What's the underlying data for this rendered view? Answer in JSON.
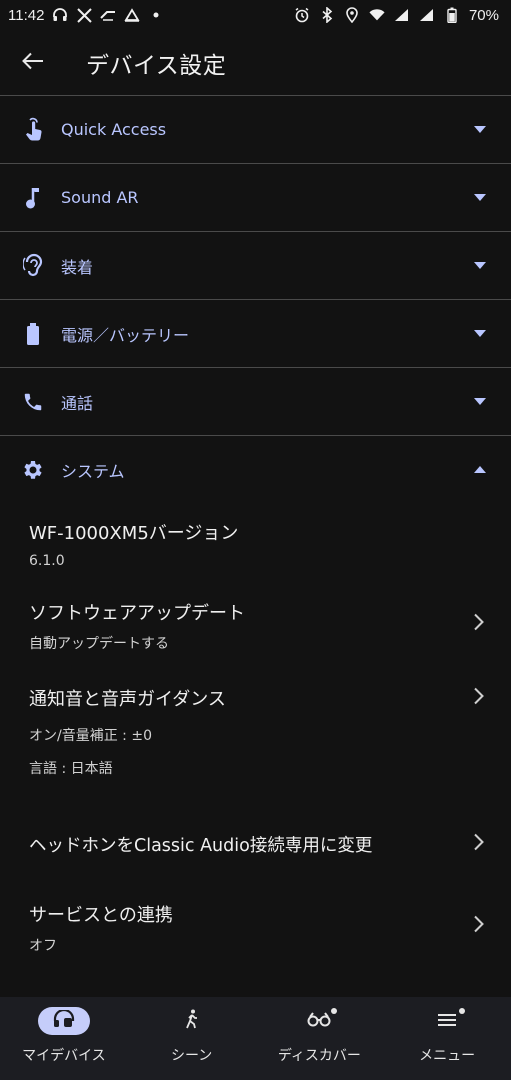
{
  "status_bar": {
    "time": "11:42",
    "battery_text": "70%"
  },
  "app_bar": {
    "title": "デバイス設定"
  },
  "sections": [
    {
      "label": "Quick Access",
      "icon": "touch-icon"
    },
    {
      "label": "Sound AR",
      "icon": "music-note-icon"
    },
    {
      "label": "装着",
      "icon": "ear-icon"
    },
    {
      "label": "電源／バッテリー",
      "icon": "battery-icon"
    },
    {
      "label": "通話",
      "icon": "phone-icon"
    },
    {
      "label": "システム",
      "icon": "gear-icon"
    }
  ],
  "system": {
    "version_title": "WF-1000XM5バージョン",
    "version_value": "6.1.0",
    "software_update_title": "ソフトウェアアップデート",
    "software_update_sub": "自動アップデートする",
    "notification_title": "通知音と音声ガイダンス",
    "notification_sub1": "オン/音量補正 : ±0",
    "notification_sub2": "言語 : 日本語",
    "classic_audio_title": "ヘッドホンをClassic Audio接続専用に変更",
    "services_title": "サービスとの連携",
    "services_sub": "オフ"
  },
  "bottom_nav": [
    {
      "label": "マイデバイス",
      "active": true
    },
    {
      "label": "シーン",
      "active": false
    },
    {
      "label": "ディスカバー",
      "active": false
    },
    {
      "label": "メニュー",
      "active": false
    }
  ],
  "colors": {
    "background": "#121212",
    "accent_text": "#b9c6ff",
    "active_pill": "#c5cdfa",
    "nav_background": "#1c1d22"
  }
}
